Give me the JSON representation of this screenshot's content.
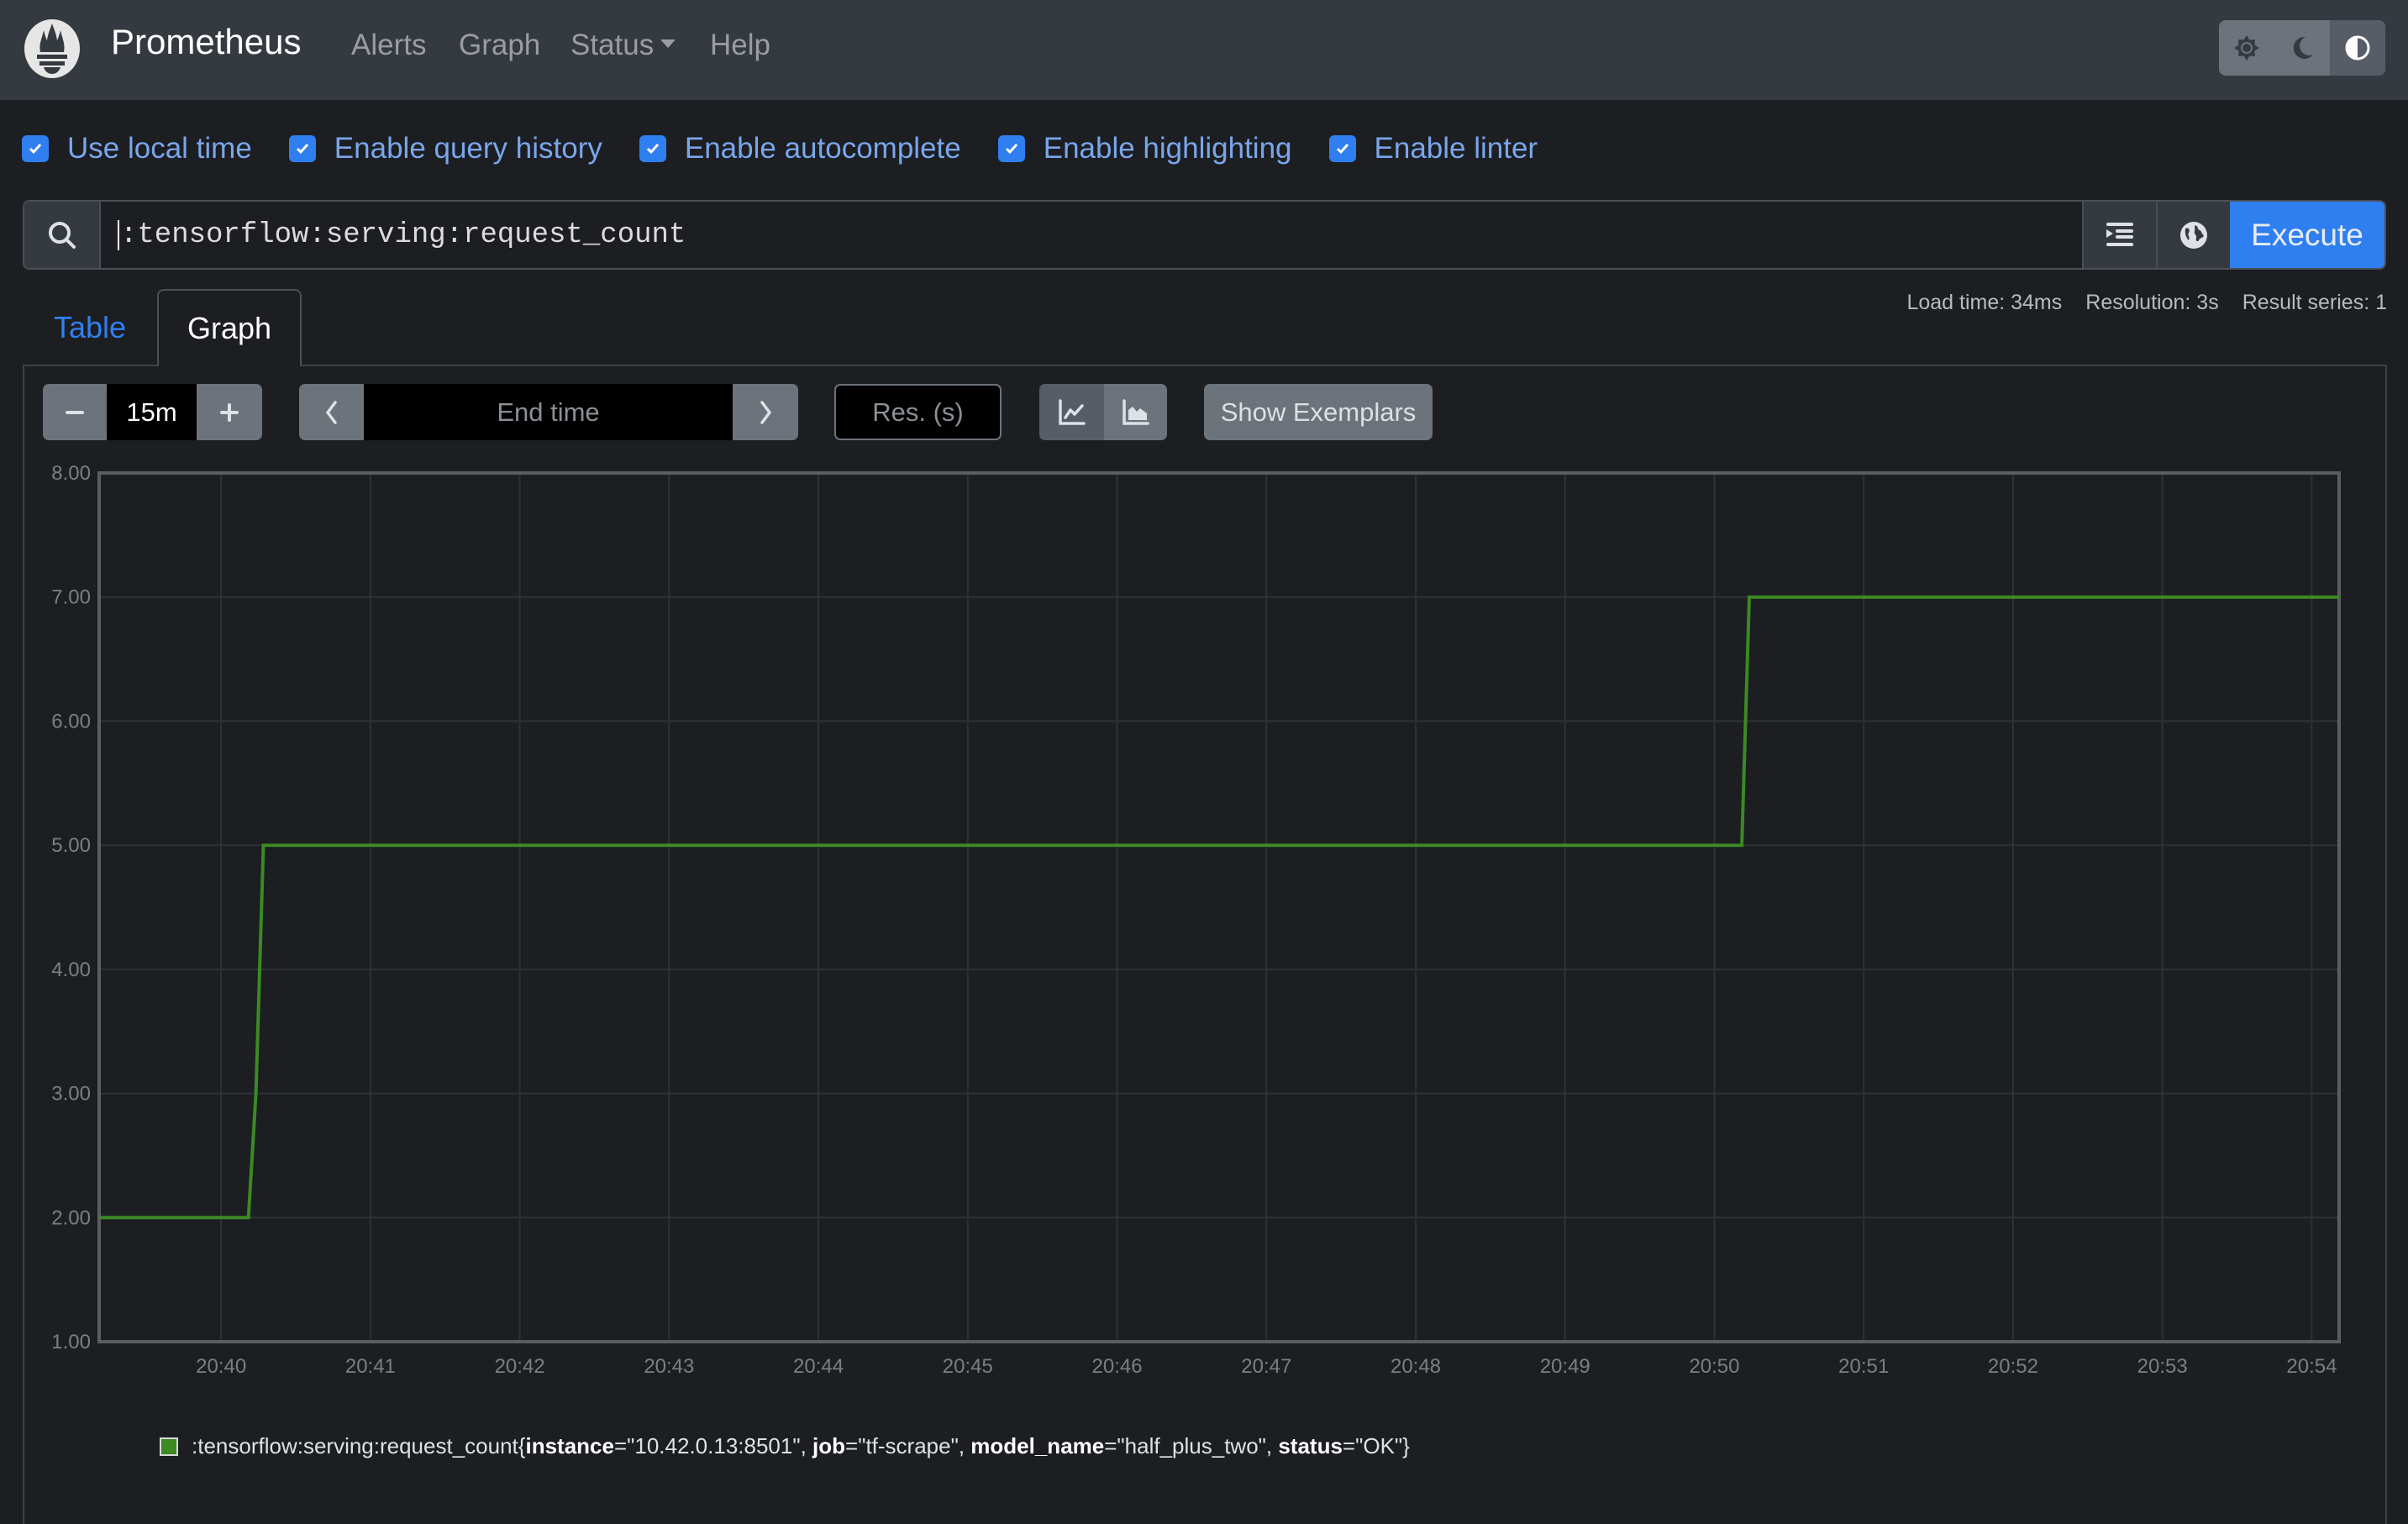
{
  "navbar": {
    "brand": "Prometheus",
    "links": [
      "Alerts",
      "Graph",
      "Status",
      "Help"
    ],
    "theme_buttons": [
      {
        "icon": "sun-icon",
        "label": "Light theme"
      },
      {
        "icon": "moon-icon",
        "label": "Dark theme"
      },
      {
        "icon": "contrast-icon",
        "label": "Browser default theme",
        "active": true
      }
    ]
  },
  "options": [
    {
      "label": "Use local time",
      "checked": true
    },
    {
      "label": "Enable query history",
      "checked": true
    },
    {
      "label": "Enable autocomplete",
      "checked": true
    },
    {
      "label": "Enable highlighting",
      "checked": true
    },
    {
      "label": "Enable linter",
      "checked": true
    }
  ],
  "query": {
    "value": ":tensorflow:serving:request_count",
    "execute_label": "Execute"
  },
  "tabs": {
    "table": "Table",
    "graph": "Graph",
    "active": "Graph"
  },
  "stats": {
    "load_time": "Load time: 34ms",
    "resolution": "Resolution: 3s",
    "result_series": "Result series: 1"
  },
  "controls": {
    "range": "15m",
    "end_time_placeholder": "End time",
    "resolution_placeholder": "Res. (s)",
    "show_exemplars": "Show Exemplars",
    "chart_mode": "line"
  },
  "colors": {
    "accent": "#2f7ff0",
    "series": "#3b8a22"
  },
  "legend": {
    "metric": ":tensorflow:serving:request_count",
    "labels": [
      {
        "key": "instance",
        "value": "\"10.42.0.13:8501\""
      },
      {
        "key": "job",
        "value": "\"tf-scrape\""
      },
      {
        "key": "model_name",
        "value": "\"half_plus_two\""
      },
      {
        "key": "status",
        "value": "\"OK\""
      }
    ]
  },
  "chart_data": {
    "type": "line",
    "title": "",
    "xlabel": "",
    "ylabel": "",
    "ylim": [
      1,
      8
    ],
    "xlim": [
      "20:39:11",
      "20:54:11"
    ],
    "grid": true,
    "yticks": [
      "1.00",
      "2.00",
      "3.00",
      "4.00",
      "5.00",
      "6.00",
      "7.00",
      "8.00"
    ],
    "xticks": [
      "20:40",
      "20:41",
      "20:42",
      "20:43",
      "20:44",
      "20:45",
      "20:46",
      "20:47",
      "20:48",
      "20:49",
      "20:50",
      "20:51",
      "20:52",
      "20:53",
      "20:54"
    ],
    "legend_position": "bottom-left",
    "series": [
      {
        "name": ":tensorflow:serving:request_count{instance=\"10.42.0.13:8501\", job=\"tf-scrape\", model_name=\"half_plus_two\", status=\"OK\"}",
        "color": "#3b8a22",
        "points": [
          [
            "20:39:11",
            2
          ],
          [
            "20:40:11",
            2
          ],
          [
            "20:40:14",
            3
          ],
          [
            "20:40:17",
            5
          ],
          [
            "20:50:11",
            5
          ],
          [
            "20:50:14",
            7
          ],
          [
            "20:54:11",
            7
          ]
        ]
      }
    ]
  }
}
